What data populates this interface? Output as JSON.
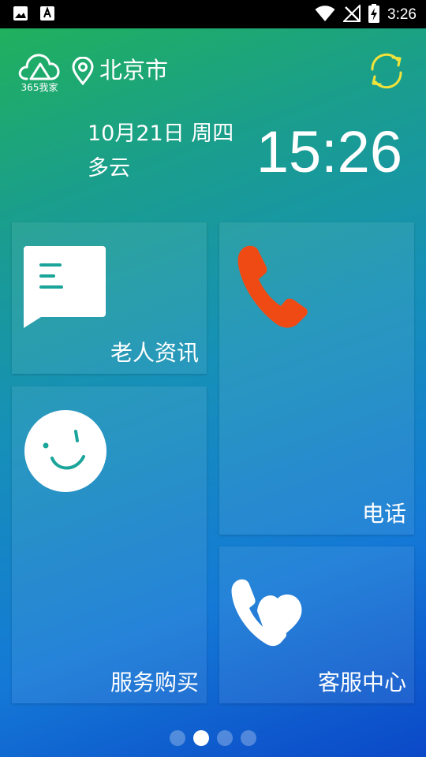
{
  "status_bar": {
    "time": "3:26",
    "icons": [
      "image-icon",
      "font-icon",
      "wifi-icon",
      "no-signal-icon",
      "battery-charging-icon"
    ]
  },
  "header": {
    "logo_text": "365我家",
    "city": "北京市",
    "date": "10月21日 周四",
    "weather": "多云",
    "clock": "15:26"
  },
  "tiles": {
    "news": {
      "label": "老人资讯",
      "icon": "message-icon"
    },
    "phone": {
      "label": "电话",
      "icon": "phone-icon"
    },
    "service": {
      "label": "服务购买",
      "icon": "smile-icon"
    },
    "support": {
      "label": "客服中心",
      "icon": "phone-heart-icon"
    }
  },
  "pager": {
    "count": 4,
    "active_index": 1
  },
  "colors": {
    "accent_yellow": "#f2e33c",
    "phone_orange": "#f04a14",
    "teal": "#1aa49a"
  }
}
